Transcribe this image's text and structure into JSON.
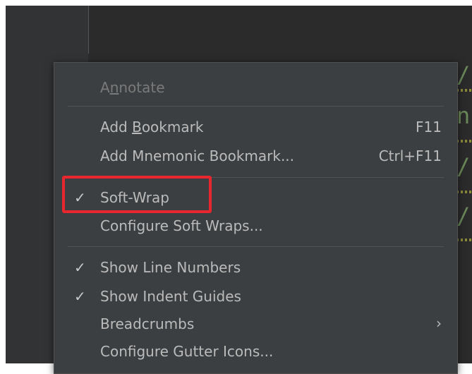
{
  "menu": {
    "annotate": {
      "label": "Annotate",
      "mnemonic": "n",
      "enabled": false
    },
    "add_bookmark": {
      "label": "Add Bookmark",
      "mnemonic": "B",
      "shortcut": "F11"
    },
    "add_mnemonic_bookmark": {
      "label": "Add Mnemonic Bookmark...",
      "shortcut": "Ctrl+F11"
    },
    "soft_wrap": {
      "label": "Soft-Wrap",
      "checked": true,
      "check": "✓"
    },
    "configure_soft_wraps": {
      "label": "Configure Soft Wraps..."
    },
    "show_line_numbers": {
      "label": "Show Line Numbers",
      "checked": true,
      "check": "✓"
    },
    "show_indent_guides": {
      "label": "Show Indent Guides",
      "checked": true,
      "check": "✓"
    },
    "breadcrumbs": {
      "label": "Breadcrumbs",
      "submenu_arrow": "›"
    },
    "configure_gutter_icons": {
      "label": "Configure Gutter Icons..."
    }
  },
  "colors": {
    "menu_background": "#3c3f41",
    "editor_background": "#2b2b2b",
    "text": "#bbbbbb",
    "disabled_text": "#7a7a7a",
    "highlight": "#e8262d",
    "code_string": "#6a8759"
  }
}
